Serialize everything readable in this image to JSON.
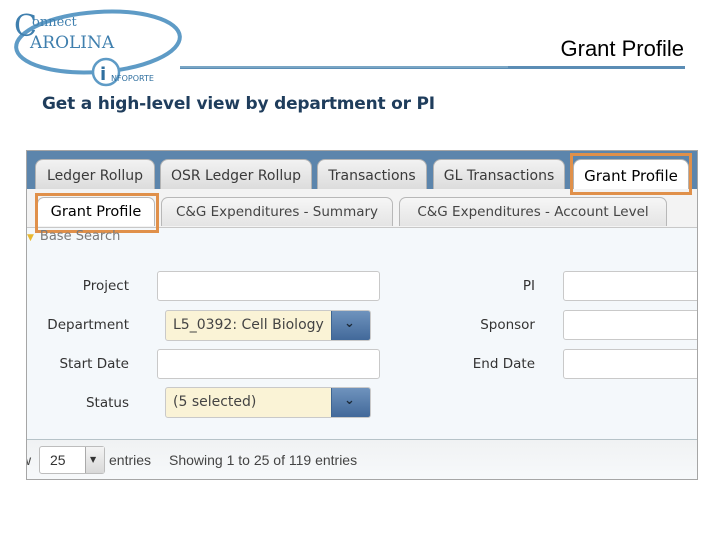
{
  "header": {
    "logo": {
      "line1": "onnect",
      "line2": "AROLINA",
      "badge": "NFOPORTE"
    },
    "page_title": "Grant Profile",
    "subtitle": "Get a high-level view by department or PI"
  },
  "tabs_primary": [
    {
      "label": "Ledger Rollup",
      "active": false
    },
    {
      "label": "OSR Ledger Rollup",
      "active": false
    },
    {
      "label": "Transactions",
      "active": false
    },
    {
      "label": "GL Transactions",
      "active": false
    },
    {
      "label": "Grant Profile",
      "active": true
    }
  ],
  "tabs_secondary": [
    {
      "label": "Grant Profile",
      "active": true
    },
    {
      "label": "C&G Expenditures - Summary",
      "active": false
    },
    {
      "label": "C&G Expenditures - Account Level",
      "active": false
    }
  ],
  "search": {
    "section_label": "Base Search",
    "fields": {
      "project": {
        "label": "Project",
        "value": ""
      },
      "department": {
        "label": "Department",
        "value": "L5_0392: Cell Biology"
      },
      "start_date": {
        "label": "Start Date",
        "value": ""
      },
      "status": {
        "label": "Status",
        "value": "(5 selected)"
      },
      "pi": {
        "label": "PI",
        "value": ""
      },
      "sponsor": {
        "label": "Sponsor",
        "value": ""
      },
      "end_date": {
        "label": "End Date",
        "value": ""
      }
    }
  },
  "table_footer": {
    "show_label": "w",
    "page_length": "25",
    "entries_label": "entries",
    "info": "Showing 1 to 25 of 119 entries"
  },
  "colors": {
    "highlight": "#e0904a",
    "tabbar": "#5c85ac",
    "subtitle": "#1f3d5c",
    "select_bg": "#faf3d6"
  }
}
